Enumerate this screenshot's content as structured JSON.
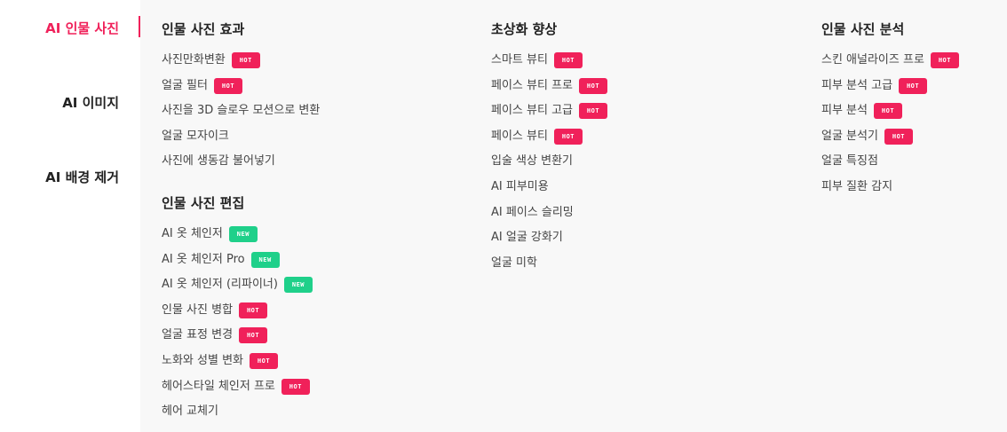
{
  "nav": {
    "items": [
      {
        "label": "AI 인물 사진",
        "active": true
      },
      {
        "label": "AI 이미지",
        "active": false
      },
      {
        "label": "AI 배경 제거",
        "active": false
      }
    ]
  },
  "colors": {
    "accent": "#f0215a",
    "hot_badge": "#f0215a",
    "new_badge": "#1fd08a",
    "panel_bg": "#f8f8f8"
  },
  "badges": {
    "hot": "HOT",
    "new": "NEW"
  },
  "columns": [
    {
      "sections": [
        {
          "title": "인물 사진 효과",
          "items": [
            {
              "label": "사진만화변환",
              "badge": "hot"
            },
            {
              "label": "얼굴 필터",
              "badge": "hot"
            },
            {
              "label": "사진을 3D 슬로우 모션으로 변환",
              "badge": ""
            },
            {
              "label": "얼굴 모자이크",
              "badge": ""
            },
            {
              "label": "사진에 생동감 불어넣기",
              "badge": ""
            }
          ]
        },
        {
          "title": "인물 사진 편집",
          "items": [
            {
              "label": "AI 옷 체인저",
              "badge": "new"
            },
            {
              "label": "AI 옷 체인저 Pro",
              "badge": "new"
            },
            {
              "label": "AI 옷 체인저 (리파이너)",
              "badge": "new"
            },
            {
              "label": "인물 사진 병합",
              "badge": "hot"
            },
            {
              "label": "얼굴 표정 변경",
              "badge": "hot"
            },
            {
              "label": "노화와 성별 변화",
              "badge": "hot"
            },
            {
              "label": "헤어스타일 체인저 프로",
              "badge": "hot"
            },
            {
              "label": "헤어 교체기",
              "badge": ""
            }
          ]
        }
      ]
    },
    {
      "sections": [
        {
          "title": "초상화 향상",
          "items": [
            {
              "label": "스마트 뷰티",
              "badge": "hot"
            },
            {
              "label": "페이스 뷰티 프로",
              "badge": "hot"
            },
            {
              "label": "페이스 뷰티 고급",
              "badge": "hot"
            },
            {
              "label": "페이스 뷰티",
              "badge": "hot"
            },
            {
              "label": "입술 색상 변환기",
              "badge": ""
            },
            {
              "label": "AI 피부미용",
              "badge": ""
            },
            {
              "label": "AI 페이스 슬리밍",
              "badge": ""
            },
            {
              "label": "AI 얼굴 강화기",
              "badge": ""
            },
            {
              "label": "얼굴 미학",
              "badge": ""
            }
          ]
        }
      ]
    },
    {
      "sections": [
        {
          "title": "인물 사진 분석",
          "items": [
            {
              "label": "스킨 애널라이즈 프로",
              "badge": "hot"
            },
            {
              "label": "피부 분석 고급",
              "badge": "hot"
            },
            {
              "label": "피부 분석",
              "badge": "hot"
            },
            {
              "label": "얼굴 분석기",
              "badge": "hot"
            },
            {
              "label": "얼굴 특징점",
              "badge": ""
            },
            {
              "label": "피부 질환 감지",
              "badge": ""
            }
          ]
        }
      ]
    }
  ]
}
